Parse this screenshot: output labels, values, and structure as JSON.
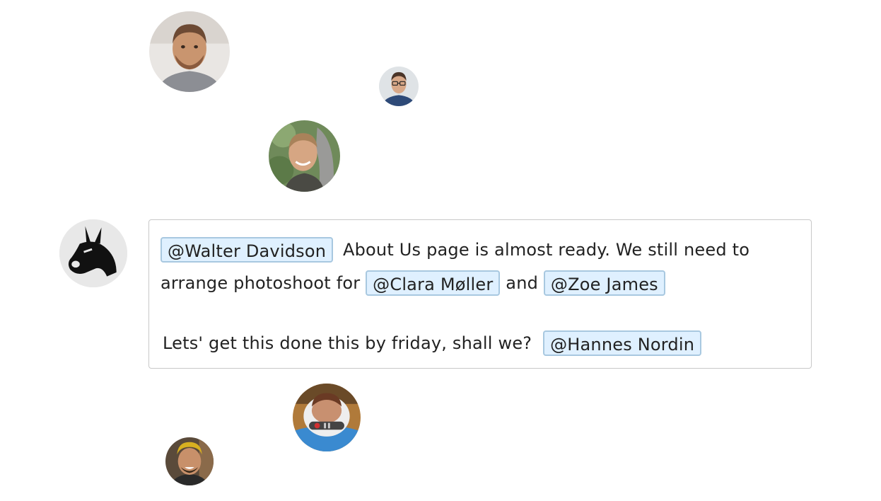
{
  "avatars": [
    {
      "id": "walter",
      "icon": "user-photo-icon"
    },
    {
      "id": "small",
      "icon": "user-photo-icon"
    },
    {
      "id": "clara",
      "icon": "user-photo-icon"
    },
    {
      "id": "author",
      "icon": "donkey-icon"
    },
    {
      "id": "astro",
      "icon": "user-photo-icon"
    },
    {
      "id": "hannes",
      "icon": "user-photo-icon"
    }
  ],
  "message": {
    "mention_walter": "@Walter Davidson",
    "text_1": "About Us page is almost ready. We still need to",
    "text_2": "arrange photoshoot for",
    "mention_clara": "@Clara Møller",
    "text_and": "and",
    "mention_zoe": "@Zoe James",
    "text_3": "Lets' get this done this by friday, shall we?",
    "mention_hannes": "@Hannes Nordin"
  },
  "colors": {
    "mention_bg": "#dff0ff",
    "mention_border": "#a8c8e0",
    "editor_border": "#c8c8c8"
  }
}
